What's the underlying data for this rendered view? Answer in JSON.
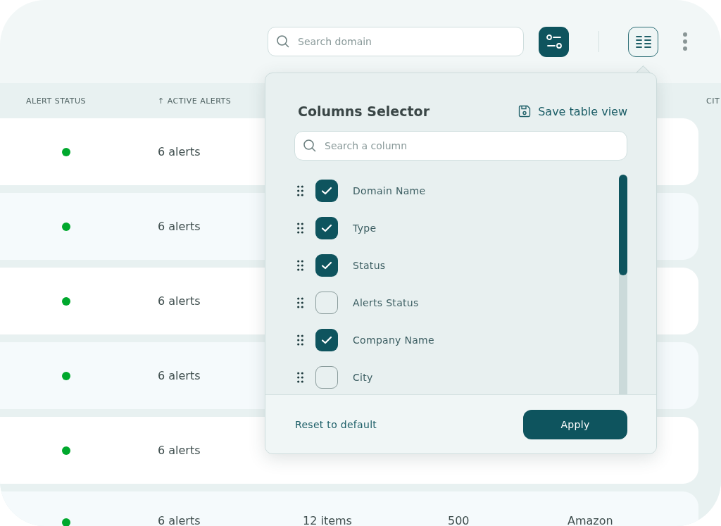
{
  "toolbar": {
    "search": {
      "placeholder": "Search domain"
    }
  },
  "table": {
    "columns": [
      {
        "label": "ALERT STATUS"
      },
      {
        "label": "↑ ACTIVE ALERTS"
      },
      {
        "label": "CIT"
      }
    ],
    "rows": [
      {
        "color": "#00a82d",
        "alerts": "6 alerts",
        "cells": []
      },
      {
        "color": "#00a82d",
        "alerts": "6 alerts",
        "cells": []
      },
      {
        "color": "#00a82d",
        "alerts": "6 alerts",
        "cells": []
      },
      {
        "color": "#00a82d",
        "alerts": "6 alerts",
        "cells": []
      },
      {
        "color": "#00a82d",
        "alerts": "6 alerts",
        "cells": []
      },
      {
        "color": "#00a82d",
        "alerts": "6 alerts",
        "cells": [
          "12 items",
          "500",
          "Amazon"
        ]
      }
    ]
  },
  "columns_selector": {
    "title": "Columns Selector",
    "save_label": "Save table view",
    "search": {
      "placeholder": "Search a column"
    },
    "columns": [
      {
        "label": "Domain Name",
        "checked": true
      },
      {
        "label": "Type",
        "checked": true
      },
      {
        "label": "Status",
        "checked": true
      },
      {
        "label": "Alerts Status",
        "checked": false
      },
      {
        "label": "Company Name",
        "checked": true
      },
      {
        "label": "City",
        "checked": false
      }
    ],
    "reset_label": "Reset to default",
    "apply_label": "Apply"
  }
}
